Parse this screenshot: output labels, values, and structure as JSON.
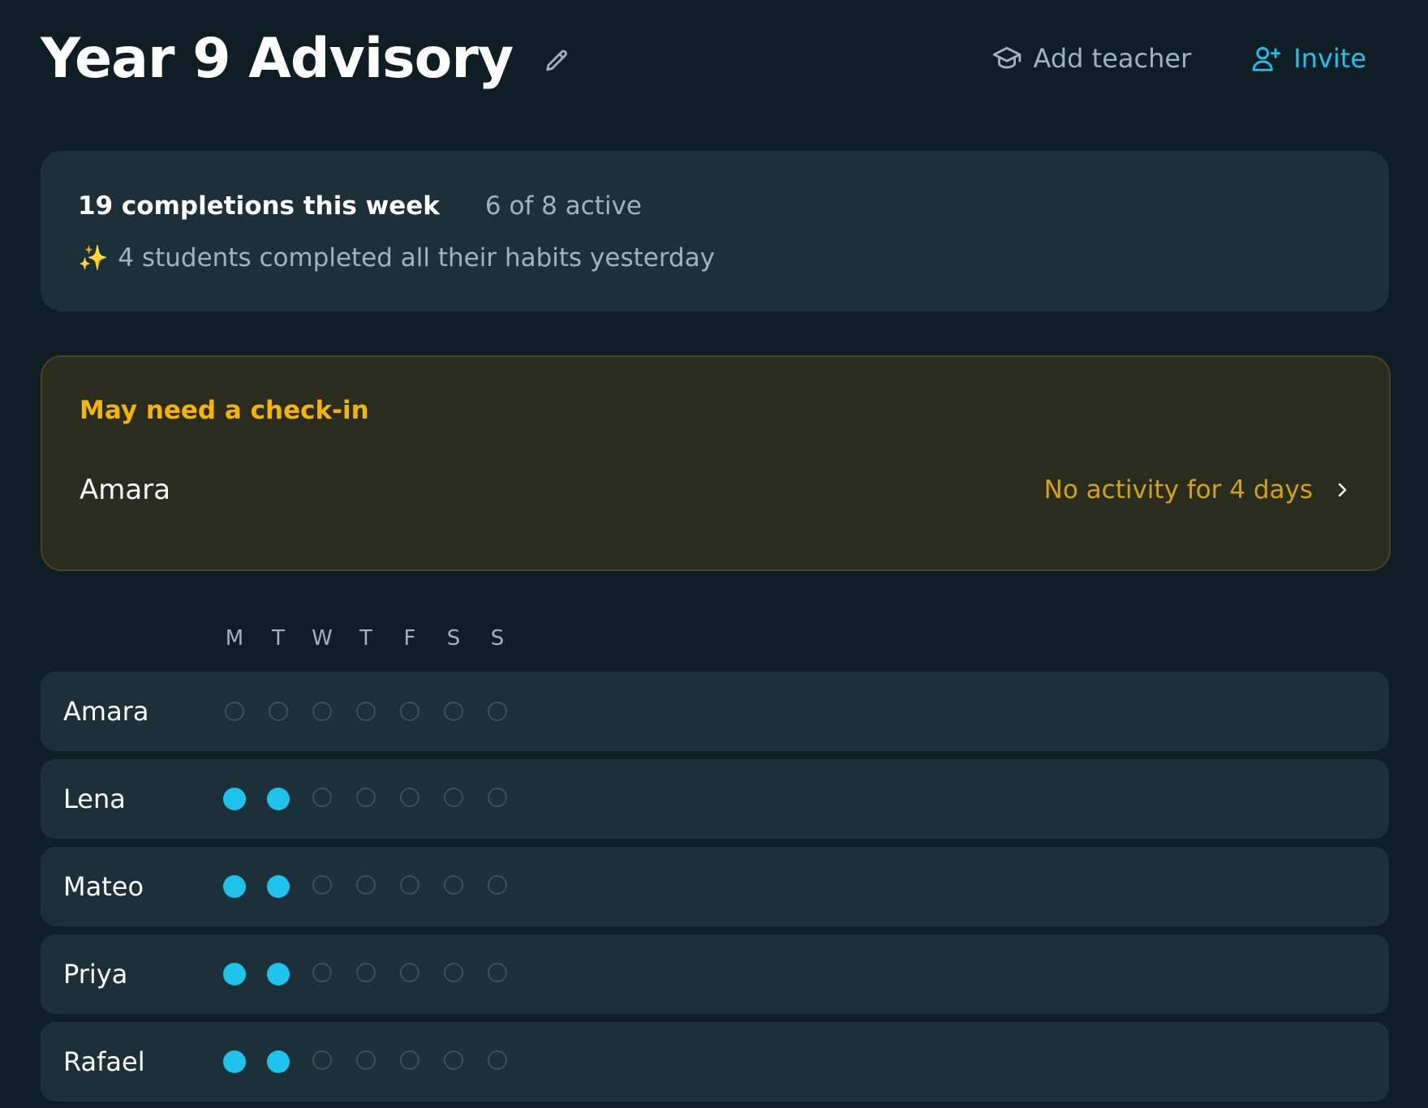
{
  "header": {
    "title": "Year 9 Advisory",
    "add_teacher_label": "Add teacher",
    "invite_label": "Invite"
  },
  "summary": {
    "completions": "19 completions this week",
    "active": "6 of 8 active",
    "highlight_icon": "✨",
    "highlight": "4 students completed all their habits yesterday"
  },
  "alert": {
    "title": "May need a check-in",
    "student": "Amara",
    "status": "No activity for 4 days"
  },
  "days": [
    "M",
    "T",
    "W",
    "T",
    "F",
    "S",
    "S"
  ],
  "students": [
    {
      "name": "Amara",
      "done": [
        false,
        false,
        false,
        false,
        false,
        false,
        false
      ]
    },
    {
      "name": "Lena",
      "done": [
        true,
        true,
        false,
        false,
        false,
        false,
        false
      ]
    },
    {
      "name": "Mateo",
      "done": [
        true,
        true,
        false,
        false,
        false,
        false,
        false
      ]
    },
    {
      "name": "Priya",
      "done": [
        true,
        true,
        false,
        false,
        false,
        false,
        false
      ]
    },
    {
      "name": "Rafael",
      "done": [
        true,
        true,
        false,
        false,
        false,
        false,
        false
      ]
    }
  ],
  "colors": {
    "background": "#0f1d24",
    "card": "#1b3038",
    "accent": "#1ec3ec",
    "warning": "#f5b400",
    "warning_text": "#d2a313",
    "muted": "#9fb3ba"
  },
  "icons": {
    "edit": "pencil-icon",
    "add_teacher": "graduation-cap-icon",
    "invite": "user-plus-icon",
    "alert_open": "chevron-right-icon"
  }
}
